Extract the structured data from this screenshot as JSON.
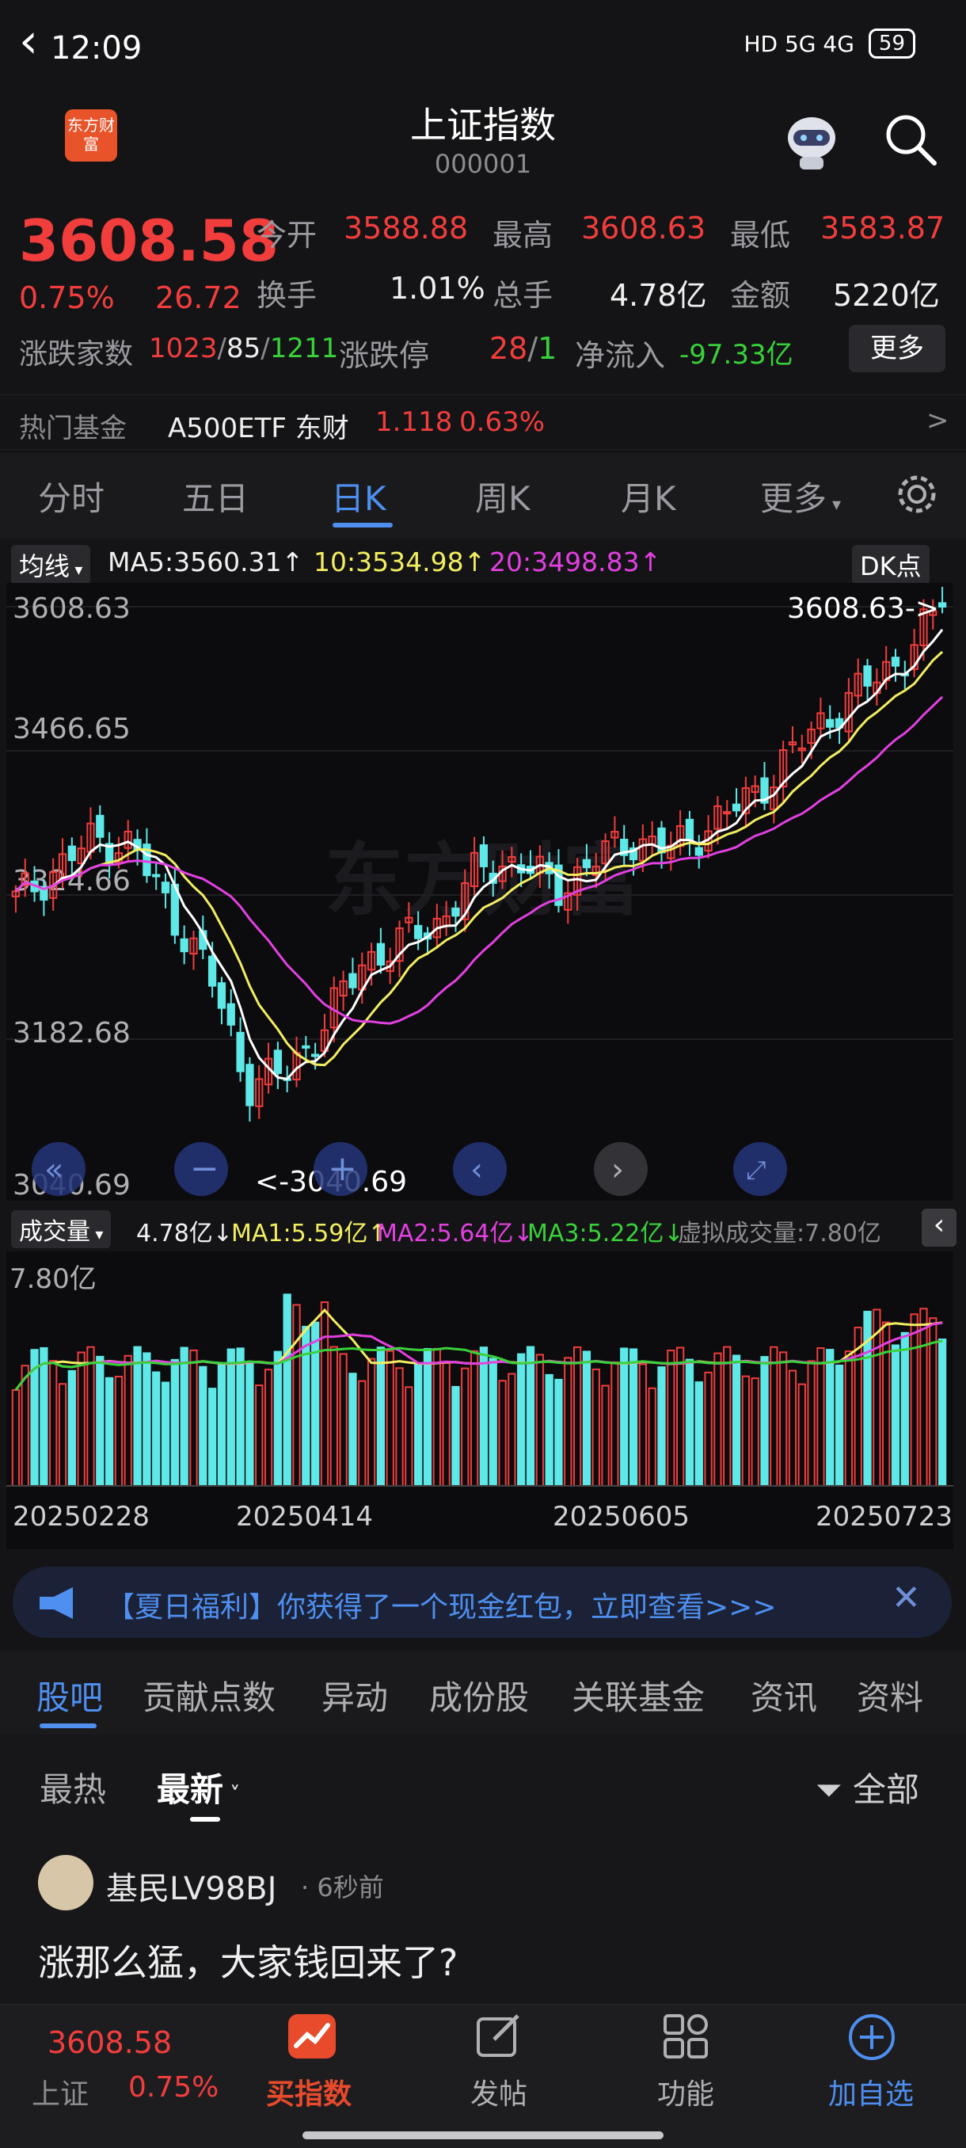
{
  "status_bar": {
    "time": "12:09",
    "network": "HD 5G 4G",
    "battery": "59"
  },
  "header": {
    "title": "上证指数",
    "code": "000001",
    "logo_text": "东方财富"
  },
  "quote": {
    "price": "3608.58",
    "change_pct": "0.75%",
    "change": "26.72",
    "open_label": "今开",
    "open": "3588.88",
    "high_label": "最高",
    "high": "3608.63",
    "low_label": "最低",
    "low": "3583.87",
    "turnover_label": "换手",
    "turnover": "1.01%",
    "volume_label": "总手",
    "volume": "4.78亿",
    "amount_label": "金额",
    "amount": "5220亿",
    "updown_label": "涨跌家数",
    "up": "1023",
    "flat": "85",
    "down": "1211",
    "limit_label": "涨跌停",
    "limit_up": "28",
    "limit_down": "1",
    "netflow_label": "净流入",
    "netflow": "-97.33亿",
    "more": "更多"
  },
  "hot_fund": {
    "label": "热门基金",
    "name": "A500ETF 东财",
    "price": "1.118",
    "pct": "0.63%",
    "arrow": ">"
  },
  "tabs": [
    "分时",
    "五日",
    "日K",
    "周K",
    "月K",
    "更多"
  ],
  "ma": {
    "selector": "均线",
    "ma5": "MA5:3560.31",
    "ma10": "10:3534.98",
    "ma20": "20:3498.83",
    "dk": "DK点"
  },
  "price_axis": [
    "3608.63",
    "3466.65",
    "3324.66",
    "3182.68",
    "3040.69"
  ],
  "markers": {
    "high": "3608.63->",
    "low": "<-3040.69",
    "watermark": "东方财富"
  },
  "volume_header": {
    "selector": "成交量",
    "vol": "4.78亿",
    "ma1": "MA1:5.59亿",
    "ma2": "MA2:5.64亿",
    "ma3": "MA3:5.22亿",
    "virtual": "虚拟成交量:7.80亿",
    "max": "7.80亿"
  },
  "date_axis": [
    "20250228",
    "20250414",
    "20250605",
    "20250723"
  ],
  "chart_data": {
    "type": "candlestick",
    "ylim": [
      3040.69,
      3608.63
    ],
    "close_samples": [
      3320,
      3350,
      3380,
      3375,
      3310,
      3250,
      3140,
      3150,
      3200,
      3260,
      3280,
      3300,
      3350,
      3360,
      3330,
      3360,
      3380,
      3370,
      3395,
      3420,
      3460,
      3500,
      3530,
      3560,
      3608.58
    ]
  },
  "banner": {
    "text": "【夏日福利】你获得了一个现金红包，立即查看>>>"
  },
  "section_tabs": [
    "股吧",
    "贡献点数",
    "异动",
    "成份股",
    "关联基金",
    "资讯",
    "资料"
  ],
  "sort": {
    "hot": "最热",
    "new": "最新",
    "filter": "全部"
  },
  "post": {
    "user": "基民LV98BJ",
    "time": "6秒前",
    "content": "涨那么猛，大家钱回来了?"
  },
  "bottom_bar": {
    "price": "3608.58",
    "index": "上证",
    "pct": "0.75%",
    "buy": "买指数",
    "post": "发帖",
    "func": "功能",
    "add": "加自选"
  }
}
